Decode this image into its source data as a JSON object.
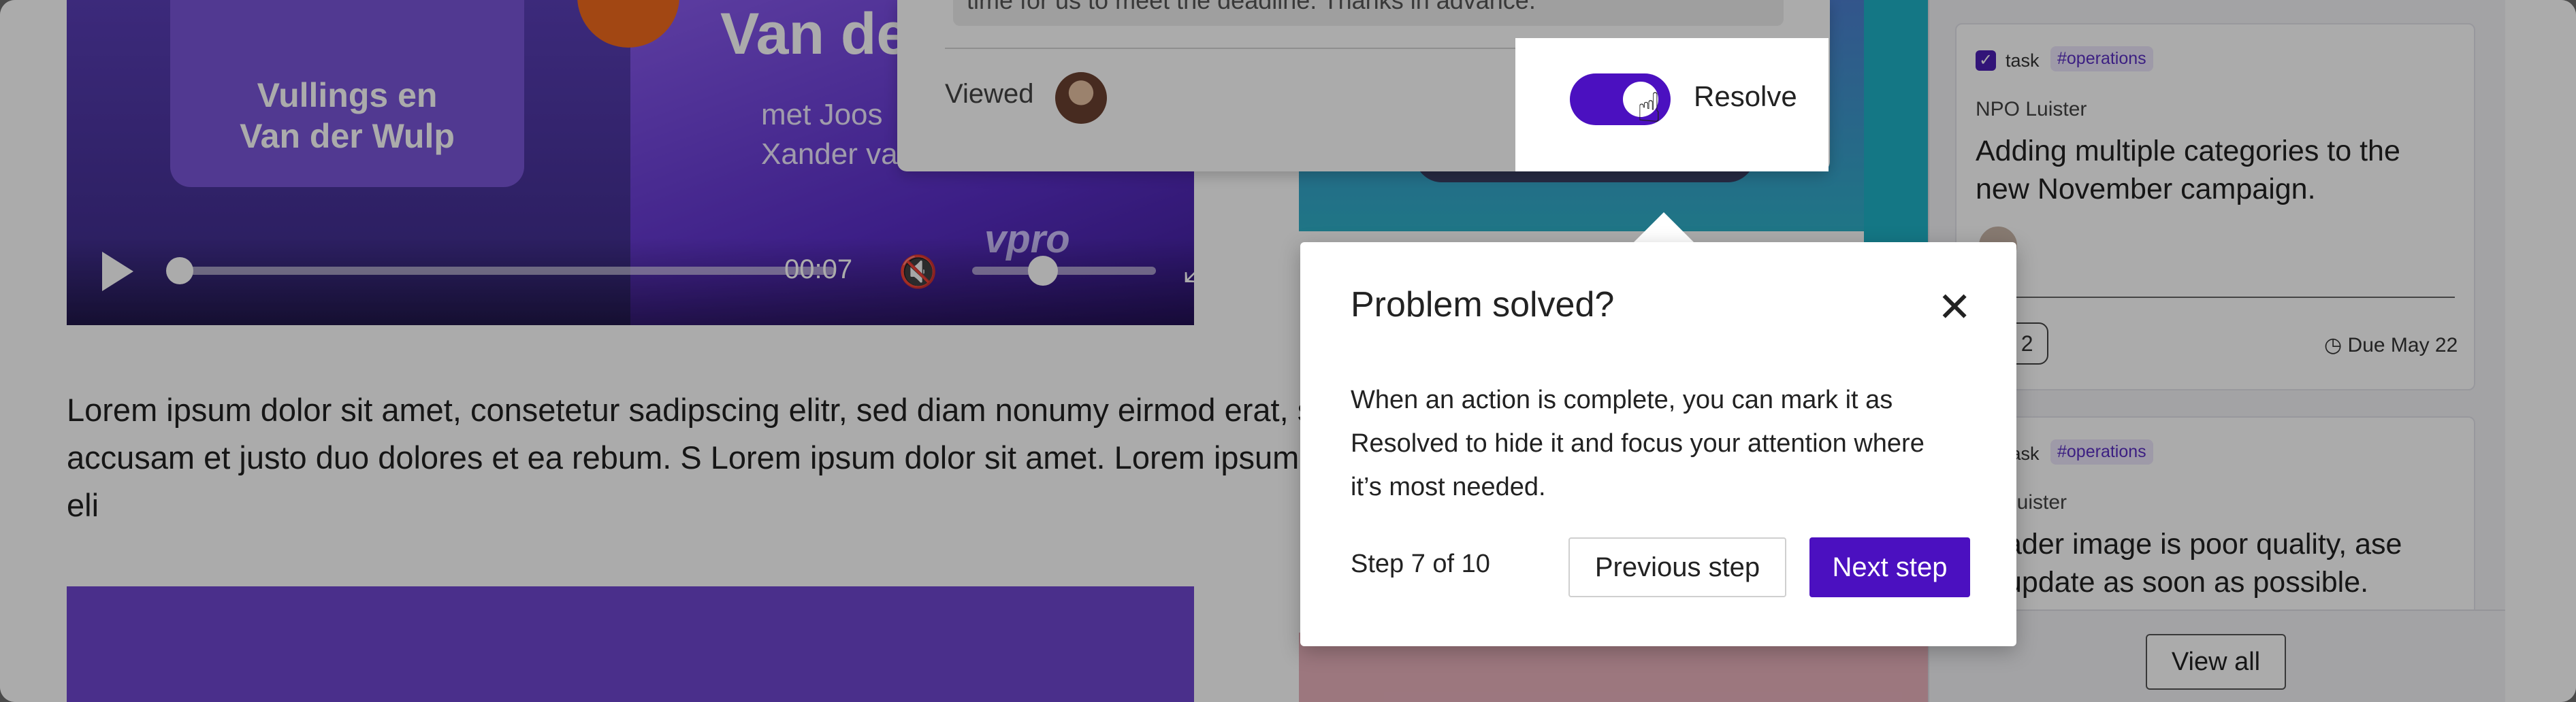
{
  "video": {
    "cover_title_line1": "Vullings en",
    "cover_title_line2": "Van der Wulp",
    "big_title": "Van de",
    "big_sub_line1": "met Joos",
    "big_sub_line2": "Xander va",
    "time": "00:07",
    "brand": "vpro"
  },
  "article": {
    "text": "Lorem ipsum dolor sit amet, consetetur sadipscing elitr, sed diam nonumy eirmod erat, sed diam voluptua. At vero eos et accusam et justo duo dolores et ea rebum. S Lorem ipsum dolor sit amet. Lorem ipsum dolor sit amet, consetetur sadipscing eli"
  },
  "comment": {
    "cut_text": "time for us to meet the deadline. Thanks in advance.",
    "viewed_label": "Viewed",
    "resolve_label": "Resolve"
  },
  "sidebar": {
    "cards": [
      {
        "type_label": "task",
        "tag": "#operations",
        "source": "NPO Luister",
        "title": "Adding multiple categories to the new November campaign.",
        "comments": "2",
        "due": "Due May 22"
      },
      {
        "type_label": "task",
        "tag": "#operations",
        "source": "Luister",
        "title": "ader image is poor quality, ase update as soon as possible."
      }
    ],
    "view_all": "View all"
  },
  "tour": {
    "title": "Problem solved?",
    "body": "When an action is complete, you can mark it as Resolved to hide it and focus your attention where it’s most needed.",
    "step": "Step 7 of 10",
    "prev_label": "Previous step",
    "next_label": "Next step"
  },
  "colors": {
    "accent": "#4b10c0",
    "tag_text": "#5a2fc2"
  },
  "icons": {
    "close": "close-icon",
    "play": "play-icon",
    "mute": "mute-icon",
    "fullscreen": "fullscreen-icon",
    "clock": "clock-icon",
    "cursor": "pointer-cursor-icon"
  }
}
